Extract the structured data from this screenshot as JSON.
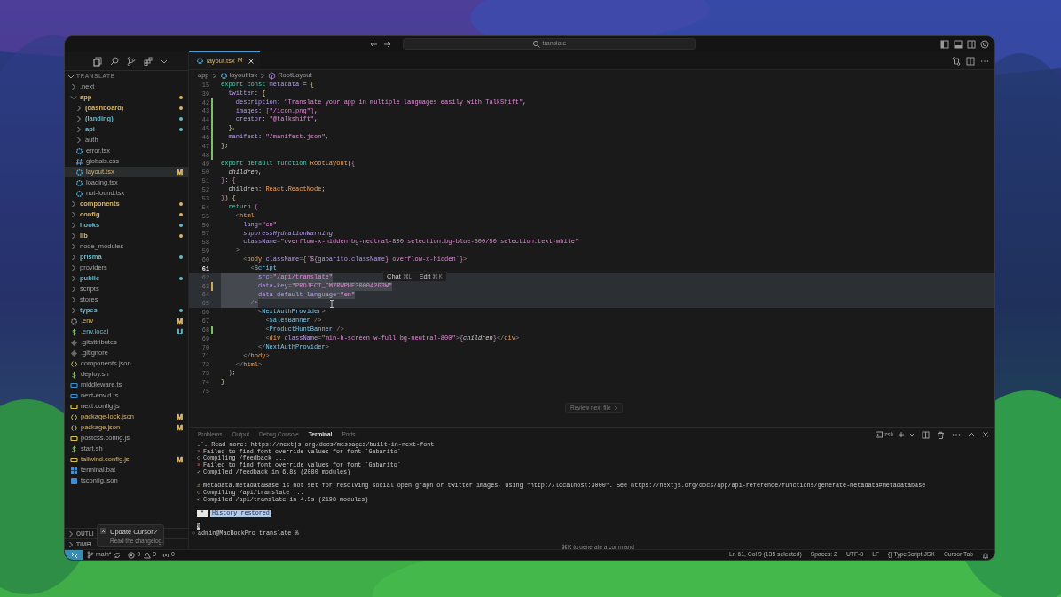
{
  "titlebar": {
    "search": {
      "value": "translate"
    }
  },
  "sidebar": {
    "title": "TRANSLATE",
    "tree": [
      {
        "label": ".next",
        "kind": "folder",
        "expanded": false
      },
      {
        "label": "app",
        "kind": "folder",
        "expanded": true,
        "color": "#d8b56a",
        "children": [
          {
            "label": "(dashboard)",
            "kind": "folder",
            "expanded": false,
            "color": "#d8b56a"
          },
          {
            "label": "(landing)",
            "kind": "folder",
            "expanded": false,
            "color": "#6cb7c9"
          },
          {
            "label": "api",
            "kind": "folder",
            "expanded": false,
            "color": "#6cb7c9"
          },
          {
            "label": "auth",
            "kind": "folder",
            "expanded": false
          },
          {
            "label": "error.tsx",
            "kind": "tsx",
            "selected": false
          },
          {
            "label": "globals.css",
            "kind": "css",
            "selected": false
          },
          {
            "label": "layout.tsx",
            "kind": "tsx",
            "color": "#d8b56a",
            "badge": "M",
            "selected": true
          },
          {
            "label": "loading.tsx",
            "kind": "tsx",
            "selected": false
          },
          {
            "label": "not-found.tsx",
            "kind": "tsx",
            "selected": false
          }
        ]
      },
      {
        "label": "components",
        "kind": "folder",
        "expanded": false,
        "color": "#d8b56a"
      },
      {
        "label": "config",
        "kind": "folder",
        "expanded": false,
        "color": "#d8b56a"
      },
      {
        "label": "hooks",
        "kind": "folder",
        "expanded": false,
        "color": "#6cb7c9"
      },
      {
        "label": "lib",
        "kind": "folder",
        "expanded": false,
        "color": "#d8b56a"
      },
      {
        "label": "node_modules",
        "kind": "folder",
        "expanded": false
      },
      {
        "label": "prisma",
        "kind": "folder",
        "expanded": false,
        "color": "#6cb7c9"
      },
      {
        "label": "providers",
        "kind": "folder",
        "expanded": false
      },
      {
        "label": "public",
        "kind": "folder",
        "expanded": false,
        "color": "#6cb7c9"
      },
      {
        "label": "scripts",
        "kind": "folder",
        "expanded": false
      },
      {
        "label": "stores",
        "kind": "folder",
        "expanded": false
      },
      {
        "label": "types",
        "kind": "folder",
        "expanded": false,
        "color": "#6cb7c9"
      },
      {
        "label": ".env",
        "kind": "env",
        "color": "#d8b56a",
        "badge": "M",
        "selected": false
      },
      {
        "label": ".env.local",
        "kind": "shell",
        "color": "#6cb7c9",
        "badge": "U",
        "selected": false
      },
      {
        "label": ".gitattributes",
        "kind": "git",
        "selected": false
      },
      {
        "label": ".gitignore",
        "kind": "git",
        "selected": false
      },
      {
        "label": "components.json",
        "kind": "json",
        "selected": false
      },
      {
        "label": "deploy.sh",
        "kind": "shell",
        "selected": false
      },
      {
        "label": "middleware.ts",
        "kind": "ts",
        "selected": false
      },
      {
        "label": "next-env.d.ts",
        "kind": "ts",
        "selected": false
      },
      {
        "label": "next.config.js",
        "kind": "js",
        "selected": false
      },
      {
        "label": "package-lock.json",
        "kind": "json",
        "color": "#d8b56a",
        "badge": "M",
        "selected": false
      },
      {
        "label": "package.json",
        "kind": "json",
        "color": "#d8b56a",
        "badge": "M",
        "selected": false
      },
      {
        "label": "postcss.config.js",
        "kind": "js",
        "selected": false
      },
      {
        "label": "start.sh",
        "kind": "shell",
        "selected": false
      },
      {
        "label": "tailwind.config.js",
        "kind": "js",
        "color": "#d8b56a",
        "badge": "M",
        "selected": false
      },
      {
        "label": "terminal.bat",
        "kind": "bat",
        "selected": false
      },
      {
        "label": "tsconfig.json",
        "kind": "tsconfig",
        "selected": false
      }
    ],
    "sections": [
      {
        "label": "OUTLI"
      },
      {
        "label": "TIMEL"
      }
    ]
  },
  "notification": {
    "title": "Update Cursor?",
    "message": "Read the changelog."
  },
  "editor": {
    "tabs": [
      {
        "label": "layout.tsx",
        "badge": "M",
        "selected": true
      }
    ],
    "breadcrumb": [
      {
        "label": "app",
        "kind": "folder"
      },
      {
        "label": "layout.tsx",
        "kind": "file"
      },
      {
        "label": "RootLayout",
        "kind": "symbol"
      }
    ],
    "lines": [
      {
        "number": "15",
        "tokens": [
          {
            "kind": "keyword",
            "text": "export const "
          },
          {
            "kind": "prop",
            "text": "metadata"
          },
          {
            "kind": "text",
            "text": " = "
          },
          {
            "kind": "brace",
            "text": "{"
          }
        ]
      },
      {
        "number": "39",
        "tokens": [
          {
            "kind": "prop",
            "text": "  twitter"
          },
          {
            "kind": "text",
            "text": ": "
          },
          {
            "kind": "brace",
            "text": "{"
          }
        ]
      },
      {
        "number": "42",
        "color": "#7fbf6a",
        "tokens": [
          {
            "kind": "prop",
            "text": "    description"
          },
          {
            "kind": "text",
            "text": ": "
          },
          {
            "kind": "string",
            "text": "\"Translate your app in multiple languages easily with TalkShift\""
          },
          {
            "kind": "text",
            "text": ","
          }
        ]
      },
      {
        "number": "43",
        "color": "#7fbf6a",
        "tokens": [
          {
            "kind": "prop",
            "text": "    images"
          },
          {
            "kind": "text",
            "text": ": "
          },
          {
            "kind": "bracket",
            "text": "["
          },
          {
            "kind": "string",
            "text": "\"/icon.png\""
          },
          {
            "kind": "bracket",
            "text": "]"
          },
          {
            "kind": "text",
            "text": ","
          }
        ]
      },
      {
        "number": "44",
        "color": "#7fbf6a",
        "tokens": [
          {
            "kind": "prop",
            "text": "    creator"
          },
          {
            "kind": "text",
            "text": ": "
          },
          {
            "kind": "string",
            "text": "\"@talkshift\""
          },
          {
            "kind": "text",
            "text": ","
          }
        ]
      },
      {
        "number": "45",
        "color": "#7fbf6a",
        "tokens": [
          {
            "kind": "brace",
            "text": "  }"
          },
          {
            "kind": "text",
            "text": ","
          }
        ]
      },
      {
        "number": "46",
        "color": "#7fbf6a",
        "tokens": [
          {
            "kind": "prop",
            "text": "  manifest"
          },
          {
            "kind": "text",
            "text": ": "
          },
          {
            "kind": "string",
            "text": "\"/manifest.json\""
          },
          {
            "kind": "text",
            "text": ","
          }
        ]
      },
      {
        "number": "47",
        "color": "#7fbf6a",
        "tokens": [
          {
            "kind": "brace",
            "text": "}"
          },
          {
            "kind": "text",
            "text": ";"
          }
        ]
      },
      {
        "number": "48",
        "color": "#7fbf6a"
      },
      {
        "number": "49",
        "tokens": [
          {
            "kind": "keyword",
            "text": "export default function "
          },
          {
            "kind": "function",
            "text": "RootLayout"
          },
          {
            "kind": "brace",
            "text": "("
          },
          {
            "kind": "bracket",
            "text": "{"
          }
        ]
      },
      {
        "number": "50",
        "tokens": [
          {
            "kind": "param",
            "text": "  children"
          },
          {
            "kind": "text",
            "text": ","
          }
        ]
      },
      {
        "number": "51",
        "tokens": [
          {
            "kind": "bracket",
            "text": "}"
          },
          {
            "kind": "text",
            "text": ": "
          },
          {
            "kind": "bracket",
            "text": "{"
          }
        ]
      },
      {
        "number": "52",
        "tokens": [
          {
            "kind": "text",
            "text": "  children: "
          },
          {
            "kind": "function",
            "text": "React"
          },
          {
            "kind": "text",
            "text": "."
          },
          {
            "kind": "function",
            "text": "ReactNode"
          },
          {
            "kind": "text",
            "text": ";"
          }
        ]
      },
      {
        "number": "53",
        "tokens": [
          {
            "kind": "bracket",
            "text": "}"
          },
          {
            "kind": "brace",
            "text": ")"
          },
          {
            "kind": "brace",
            "text": " {"
          }
        ]
      },
      {
        "number": "54",
        "tokens": [
          {
            "kind": "keyword",
            "text": "  return"
          },
          {
            "kind": "bracket",
            "text": " ("
          }
        ]
      },
      {
        "number": "55",
        "tokens": [
          {
            "kind": "punct",
            "text": "    <"
          },
          {
            "kind": "tag",
            "text": "html"
          }
        ]
      },
      {
        "number": "56",
        "tokens": [
          {
            "kind": "attr",
            "text": "      lang"
          },
          {
            "kind": "punct",
            "text": "="
          },
          {
            "kind": "string",
            "text": "\"en\""
          }
        ]
      },
      {
        "number": "57",
        "tokens": [
          {
            "kind": "attr_italic",
            "text": "      suppressHydrationWarning"
          }
        ]
      },
      {
        "number": "58",
        "tokens": [
          {
            "kind": "attr",
            "text": "      className"
          },
          {
            "kind": "punct",
            "text": "="
          },
          {
            "kind": "string",
            "text": "\"overflow-x-hidden bg-neutral-800 selection:bg-blue-500/50 selection:text-white\""
          }
        ]
      },
      {
        "number": "59",
        "tokens": [
          {
            "kind": "punct",
            "text": "    >"
          }
        ]
      },
      {
        "number": "60",
        "tokens": [
          {
            "kind": "punct",
            "text": "      <"
          },
          {
            "kind": "tag",
            "text": "body"
          },
          {
            "kind": "attr",
            "text": " className"
          },
          {
            "kind": "punct",
            "text": "="
          },
          {
            "kind": "bracket",
            "text": "{"
          },
          {
            "kind": "string",
            "text": "`${"
          },
          {
            "kind": "prop",
            "text": "gabarito.className"
          },
          {
            "kind": "string",
            "text": "} overflow-x-hidden`"
          },
          {
            "kind": "bracket",
            "text": "}"
          },
          {
            "kind": "punct",
            "text": ">"
          }
        ]
      },
      {
        "number": "61",
        "current": true,
        "tokens": [
          {
            "kind": "punct",
            "text": "        <"
          },
          {
            "kind": "component",
            "text": "Script"
          }
        ]
      },
      {
        "number": "62",
        "highlighted": true,
        "tokens": [
          {
            "kind": "attr",
            "text": "          src"
          },
          {
            "kind": "punct",
            "text": "="
          },
          {
            "kind": "string",
            "text": "\"/api/translate\""
          }
        ]
      },
      {
        "number": "63",
        "highlighted": true,
        "color": "#c9a95a",
        "tokens": [
          {
            "kind": "attr",
            "text": "          data-key"
          },
          {
            "kind": "punct",
            "text": "="
          },
          {
            "kind": "string",
            "text": "\"PROJECT_CM7RWPHE300042G3W\""
          }
        ]
      },
      {
        "number": "64",
        "highlighted": true,
        "tokens": [
          {
            "kind": "attr",
            "text": "          data-default-language"
          },
          {
            "kind": "punct",
            "text": "="
          },
          {
            "kind": "string",
            "text": "\"en\""
          }
        ]
      },
      {
        "number": "65",
        "highlighted": true,
        "tokens": [
          {
            "kind": "punct",
            "text": "        />"
          }
        ]
      },
      {
        "number": "66",
        "tokens": [
          {
            "kind": "punct",
            "text": "          <"
          },
          {
            "kind": "component",
            "text": "NextAuthProvider"
          },
          {
            "kind": "punct",
            "text": ">"
          }
        ]
      },
      {
        "number": "67",
        "tokens": [
          {
            "kind": "punct",
            "text": "            <"
          },
          {
            "kind": "component",
            "text": "SalesBanner"
          },
          {
            "kind": "punct",
            "text": " />"
          }
        ]
      },
      {
        "number": "68",
        "color": "#7fbf6a",
        "tokens": [
          {
            "kind": "punct",
            "text": "            <"
          },
          {
            "kind": "component",
            "text": "ProductHuntBanner"
          },
          {
            "kind": "punct",
            "text": " />"
          }
        ]
      },
      {
        "number": "69",
        "tokens": [
          {
            "kind": "punct",
            "text": "            <"
          },
          {
            "kind": "tag",
            "text": "div"
          },
          {
            "kind": "attr",
            "text": " className"
          },
          {
            "kind": "punct",
            "text": "="
          },
          {
            "kind": "string",
            "text": "\"min-h-screen w-full bg-neutral-800\""
          },
          {
            "kind": "punct",
            "text": ">"
          },
          {
            "kind": "bracket",
            "text": "{"
          },
          {
            "kind": "param",
            "text": "children"
          },
          {
            "kind": "bracket",
            "text": "}"
          },
          {
            "kind": "punct",
            "text": "</"
          },
          {
            "kind": "tag",
            "text": "div"
          },
          {
            "kind": "punct",
            "text": ">"
          }
        ]
      },
      {
        "number": "70",
        "tokens": [
          {
            "kind": "punct",
            "text": "          </"
          },
          {
            "kind": "component",
            "text": "NextAuthProvider"
          },
          {
            "kind": "punct",
            "text": ">"
          }
        ]
      },
      {
        "number": "71",
        "tokens": [
          {
            "kind": "punct",
            "text": "      </"
          },
          {
            "kind": "tag",
            "text": "body"
          },
          {
            "kind": "punct",
            "text": ">"
          }
        ]
      },
      {
        "number": "72",
        "tokens": [
          {
            "kind": "punct",
            "text": "    </"
          },
          {
            "kind": "tag",
            "text": "html"
          },
          {
            "kind": "punct",
            "text": ">"
          }
        ]
      },
      {
        "number": "73",
        "tokens": [
          {
            "kind": "bracket",
            "text": "  )"
          },
          {
            "kind": "text",
            "text": ";"
          }
        ]
      },
      {
        "number": "74",
        "tokens": [
          {
            "kind": "brace",
            "text": "}"
          }
        ]
      },
      {
        "number": "75"
      }
    ],
    "hover_menu": [
      {
        "label": "Chat",
        "shortcut": "⌘L"
      },
      {
        "label": "Edit",
        "shortcut": "⌘K"
      }
    ],
    "review_button": {
      "label": "Review next file"
    }
  },
  "panel": {
    "tabs": [
      {
        "label": "Problems",
        "selected": false
      },
      {
        "label": "Output",
        "selected": false
      },
      {
        "label": "Debug Console",
        "selected": false
      },
      {
        "label": "Terminal",
        "selected": true
      },
      {
        "label": "Ports",
        "selected": false
      }
    ],
    "shell": "zsh",
    "lines": [
      {
        "kind": "plain",
        "text": ".`. Read more: https://nextjs.org/docs/messages/built-in-next-font"
      },
      {
        "kind": "error",
        "marker": "×",
        "text": "Failed to find font override values for font `Gabarito`"
      },
      {
        "kind": "pending",
        "marker": "○",
        "text": "Compiling /feedback ..."
      },
      {
        "kind": "error",
        "marker": "×",
        "text": "Failed to find font override values for font `Gabarito`"
      },
      {
        "kind": "success",
        "marker": "✓",
        "text": "Compiled /feedback in 6.8s (2080 modules)"
      },
      {
        "kind": "blank"
      },
      {
        "kind": "warning",
        "marker": "⚠",
        "text": "metadata.metadataBase is not set for resolving social open graph or twitter images, using \"http://localhost:3000\". See https://nextjs.org/docs/app/api-reference/functions/generate-metadata#metadatabase"
      },
      {
        "kind": "pending",
        "marker": "○",
        "text": "Compiling /api/translate ..."
      },
      {
        "kind": "success",
        "marker": "✓",
        "text": "Compiled /api/translate in 4.5s (2198 modules)"
      },
      {
        "kind": "blank"
      },
      {
        "kind": "notice",
        "marker": "*",
        "text": "History restored"
      },
      {
        "kind": "blank"
      },
      {
        "kind": "cursor",
        "text": "%"
      },
      {
        "kind": "prompt",
        "marker": "○",
        "text": "admin@MacBookPro translate %"
      }
    ],
    "hint": "⌘K to generate a command"
  },
  "status_bar": {
    "branch": "main*",
    "errors": "0",
    "warnings": "0",
    "ports": "0",
    "items": [
      "Ln 61, Col 9 (135 selected)",
      "Spaces: 2",
      "UTF-8",
      "LF",
      "{} TypeScript JSX",
      "Cursor Tab"
    ]
  }
}
